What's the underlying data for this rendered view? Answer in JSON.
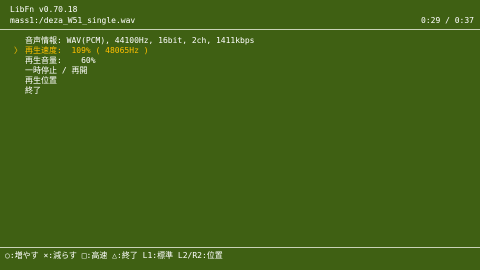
{
  "header": {
    "app_title": "LibFn v0.70.18",
    "file_path": "mass1:/deza_W51_single.wav",
    "time": "0:29 / 0:37"
  },
  "menu": {
    "cursor": "〉",
    "selected_index": 1,
    "items": [
      {
        "label": "音声情報: ",
        "value": "WAV(PCM), 44100Hz, 16bit, 2ch, 1411kbps"
      },
      {
        "label": "再生速度:  ",
        "value": "109% ( 48065Hz )"
      },
      {
        "label": "再生音量:    ",
        "value": "60%"
      },
      {
        "label": "一時停止 / 再開",
        "value": ""
      },
      {
        "label": "再生位置",
        "value": ""
      },
      {
        "label": "終了",
        "value": ""
      }
    ]
  },
  "footer": {
    "help": "○:増やす ×:減らす □:高速 △:終了 L1:標準 L2/R2:位置"
  },
  "colors": {
    "background": "#3f6013",
    "text": "#ffffff",
    "highlight": "#ffbf00"
  }
}
